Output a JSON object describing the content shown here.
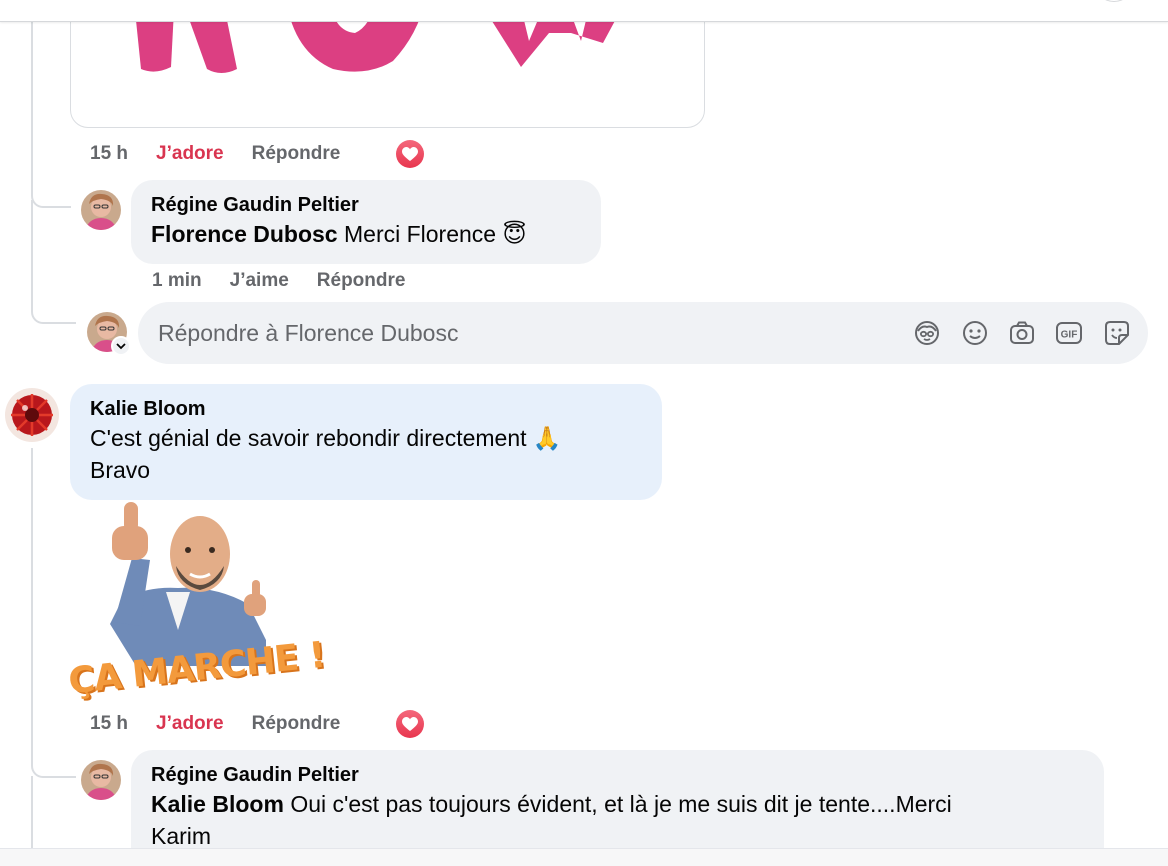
{
  "media_card": {
    "image_name": "sticker-art-partial"
  },
  "comment1_meta": {
    "time": "15 h",
    "love": "J’adore",
    "reply": "Répondre"
  },
  "reply1": {
    "author": "Régine Gaudin Peltier",
    "mention": "Florence Dubosc",
    "text": "Merci Florence",
    "emoji": "😇",
    "time": "1 min",
    "like": "J’aime",
    "reply": "Répondre"
  },
  "reply_box": {
    "placeholder": "Répondre à Florence Dubosc",
    "tools": [
      "avatar-sticker-icon",
      "emoji-icon",
      "camera-icon",
      "gif-icon",
      "sticker-icon"
    ],
    "gif_label": "GIF"
  },
  "comment2": {
    "author": "Kalie Bloom",
    "text_line1": "C'est génial de savoir rebondir directement",
    "emoji": "🙏",
    "text_line2": "Bravo",
    "sticker_caption": "ÇA MARCHE !",
    "time": "15 h",
    "love": "J’adore",
    "reply": "Répondre"
  },
  "reply2": {
    "author": "Régine Gaudin Peltier",
    "mention": "Kalie Bloom",
    "text_line1": "Oui c'est pas toujours évident, et là je me suis dit je tente....Merci",
    "text_line2": "Karim"
  },
  "colors": {
    "love": "#d93550",
    "meta": "#65676b",
    "bubble_grey": "#f0f2f5",
    "bubble_blue": "#e7f0fb",
    "sticker_orange": "#f39a3c"
  }
}
